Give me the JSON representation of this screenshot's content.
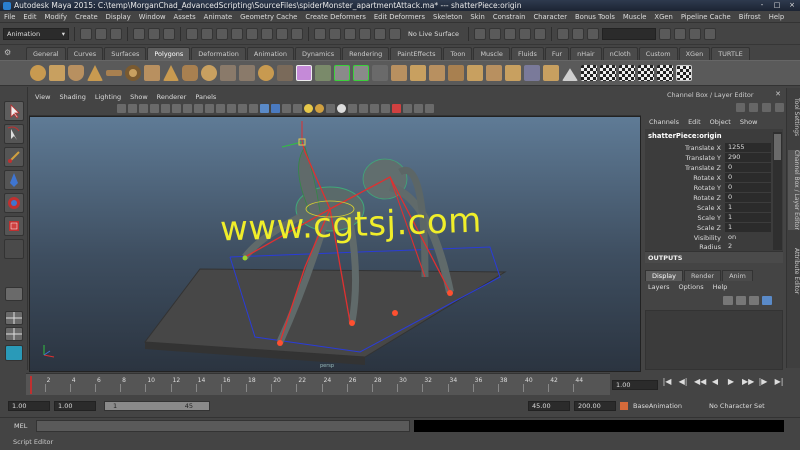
{
  "window": {
    "title": "Autodesk Maya 2015: C:\\temp\\MorganChad_AdvancedScripting\\SourceFiles\\spiderMonster_apartmentAttack.ma*  ---  shatterPiece:origin",
    "controls": [
      "-",
      "□",
      "×"
    ]
  },
  "menubar": [
    "File",
    "Edit",
    "Modify",
    "Create",
    "Display",
    "Window",
    "Assets",
    "Animate",
    "Geometry Cache",
    "Create Deformers",
    "Edit Deformers",
    "Skeleton",
    "Skin",
    "Constrain",
    "Character",
    "Bonus Tools",
    "Muscle",
    "XGen",
    "Pipeline Cache",
    "Bifrost",
    "Help"
  ],
  "statusline": {
    "menuset": "Animation",
    "live_surface": "No Live Surface"
  },
  "shelf": {
    "tabs": [
      "General",
      "Curves",
      "Surfaces",
      "Polygons",
      "Deformation",
      "Animation",
      "Dynamics",
      "Rendering",
      "PaintEffects",
      "Toon",
      "Muscle",
      "Fluids",
      "Fur",
      "nHair",
      "nCloth",
      "Custom",
      "XGen",
      "TURTLE"
    ],
    "active_tab": "Polygons"
  },
  "viewport": {
    "menu": [
      "View",
      "Shading",
      "Lighting",
      "Show",
      "Renderer",
      "Panels"
    ],
    "watermark": "www.cgtsj.com",
    "camera_label": "persp"
  },
  "channel_box": {
    "header": "Channel Box / Layer Editor",
    "menu": [
      "Channels",
      "Edit",
      "Object",
      "Show"
    ],
    "object_name": "shatterPiece:origin",
    "attributes": [
      {
        "label": "Translate X",
        "value": "1255"
      },
      {
        "label": "Translate Y",
        "value": "290"
      },
      {
        "label": "Translate Z",
        "value": "0"
      },
      {
        "label": "Rotate X",
        "value": "0"
      },
      {
        "label": "Rotate Y",
        "value": "0"
      },
      {
        "label": "Rotate Z",
        "value": "0"
      },
      {
        "label": "Scale X",
        "value": "1"
      },
      {
        "label": "Scale Y",
        "value": "1"
      },
      {
        "label": "Scale Z",
        "value": "1"
      },
      {
        "label": "Visibility",
        "value": "on"
      },
      {
        "label": "Radius",
        "value": "2"
      }
    ],
    "outputs_label": "OUTPUTS"
  },
  "layer_editor": {
    "tabs": [
      "Display",
      "Render",
      "Anim"
    ],
    "active_tab": "Display",
    "menu": [
      "Layers",
      "Options",
      "Help"
    ]
  },
  "side_tabs": [
    "Tool Settings",
    "Channel Box / Layer Editor",
    "Attribute Editor"
  ],
  "time_slider": {
    "ticks": [
      "2",
      "4",
      "6",
      "8",
      "10",
      "12",
      "14",
      "16",
      "18",
      "20",
      "22",
      "24",
      "26",
      "28",
      "30",
      "32",
      "34",
      "36",
      "38",
      "40",
      "42",
      "44"
    ],
    "current_frame": "1.00",
    "playback_controls": [
      "|◀",
      "◀|",
      "◀◀",
      "◀",
      "▶",
      "▶▶",
      "|▶",
      "▶|"
    ]
  },
  "range_slider": {
    "start": "1.00",
    "playback_start": "1.00",
    "range_start": "1",
    "range_end": "45",
    "playback_end": "45.00",
    "end": "200.00",
    "anim_layer": "BaseAnimation",
    "character_set": "No Character Set"
  },
  "command_line": {
    "label": "MEL"
  },
  "help_line": {
    "label": "Script Editor"
  },
  "colors": {
    "ui_bg": "#444444",
    "viewport_top": "#5f7b96",
    "watermark": "#f0ee2a",
    "selection_red": "#e03030"
  }
}
